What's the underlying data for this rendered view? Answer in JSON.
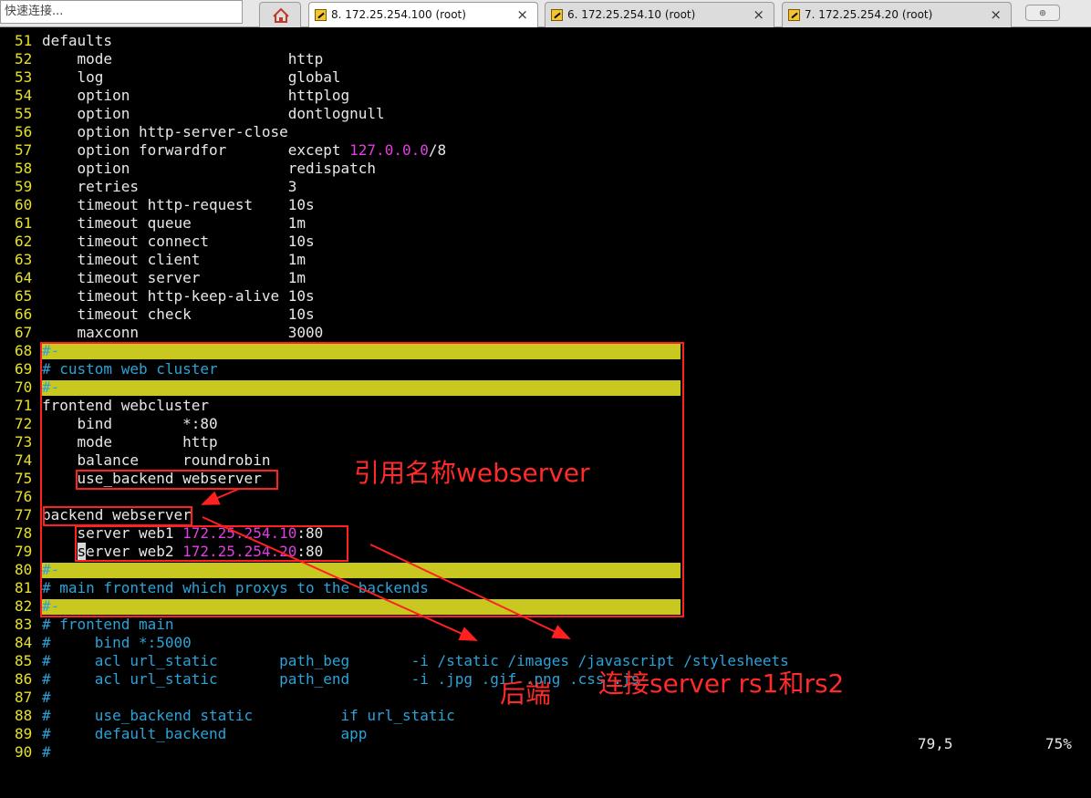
{
  "quick_connect": {
    "placeholder": "快速连接..."
  },
  "tabs": [
    {
      "label": "8. 172.25.254.100 (root)",
      "active": true
    },
    {
      "label": "6. 172.25.254.10 (root)",
      "active": false
    },
    {
      "label": "7. 172.25.254.20 (root)",
      "active": false
    }
  ],
  "tab_close_glyph": "×",
  "new_tab_glyph": "⊕",
  "lines": [
    {
      "n": "51",
      "t": "defaults"
    },
    {
      "n": "52",
      "t": "    mode                    http"
    },
    {
      "n": "53",
      "t": "    log                     global"
    },
    {
      "n": "54",
      "t": "    option                  httplog"
    },
    {
      "n": "55",
      "t": "    option                  dontlognull"
    },
    {
      "n": "56",
      "t": "    option http-server-close"
    },
    {
      "n": "57",
      "t": "    option forwardfor       except ",
      "ip": "127.0.0.0",
      "tail": "/8"
    },
    {
      "n": "58",
      "t": "    option                  redispatch"
    },
    {
      "n": "59",
      "t": "    retries                 3"
    },
    {
      "n": "60",
      "t": "    timeout http-request    10s"
    },
    {
      "n": "61",
      "t": "    timeout queue           1m"
    },
    {
      "n": "62",
      "t": "    timeout connect         10s"
    },
    {
      "n": "63",
      "t": "    timeout client          1m"
    },
    {
      "n": "64",
      "t": "    timeout server          1m"
    },
    {
      "n": "65",
      "t": "    timeout http-keep-alive 10s"
    },
    {
      "n": "66",
      "t": "    timeout check           10s"
    },
    {
      "n": "67",
      "t": "    maxconn                 3000"
    },
    {
      "n": "68",
      "t": "#-",
      "bar": true
    },
    {
      "n": "69",
      "t": "# custom web cluster",
      "comment": true
    },
    {
      "n": "70",
      "t": "#-",
      "bar": true
    },
    {
      "n": "71",
      "t": "frontend webcluster"
    },
    {
      "n": "72",
      "t": "    bind        *:80"
    },
    {
      "n": "73",
      "t": "    mode        http"
    },
    {
      "n": "74",
      "t": "    balance     roundrobin"
    },
    {
      "n": "75",
      "t": "    use_backend webserver"
    },
    {
      "n": "76",
      "t": ""
    },
    {
      "n": "77",
      "t": "backend webserver"
    },
    {
      "n": "78",
      "t": "    server web1 ",
      "ip": "172.25.254.10",
      "tail": ":80"
    },
    {
      "n": "79",
      "t": "    ",
      "cursor": "s",
      "t2": "erver web2 ",
      "ip": "172.25.254.20",
      "tail": ":80"
    },
    {
      "n": "80",
      "t": "#-",
      "bar": true
    },
    {
      "n": "81",
      "t": "# main frontend which proxys to the backends",
      "comment": true
    },
    {
      "n": "82",
      "t": "#-",
      "bar": true
    },
    {
      "n": "83",
      "t": "# frontend main",
      "comment": true
    },
    {
      "n": "84",
      "t": "#     bind *:5000",
      "comment": true
    },
    {
      "n": "85",
      "t": "#     acl url_static       path_beg       -i /static /images /javascript /stylesheets",
      "comment": true
    },
    {
      "n": "86",
      "t": "#     acl url_static       path_end       -i .jpg .gif .png .css .js",
      "comment": true
    },
    {
      "n": "87",
      "t": "#",
      "comment": true
    },
    {
      "n": "88",
      "t": "#     use_backend static          if url_static",
      "comment": true
    },
    {
      "n": "89",
      "t": "#     default_backend             app",
      "comment": true
    },
    {
      "n": "90",
      "t": "#",
      "comment": true
    }
  ],
  "status": {
    "position": "79,5",
    "percent": "75%"
  },
  "annotations": {
    "ref_name": "引用名称webserver",
    "backend": "后端",
    "connect": "连接server rs1和rs2"
  },
  "colors": {
    "line_number": "#e6e02a",
    "comment": "#2ba3d8",
    "ip": "#e040e0",
    "highlight_bar": "#c8c820",
    "annotation": "#ff2020"
  }
}
